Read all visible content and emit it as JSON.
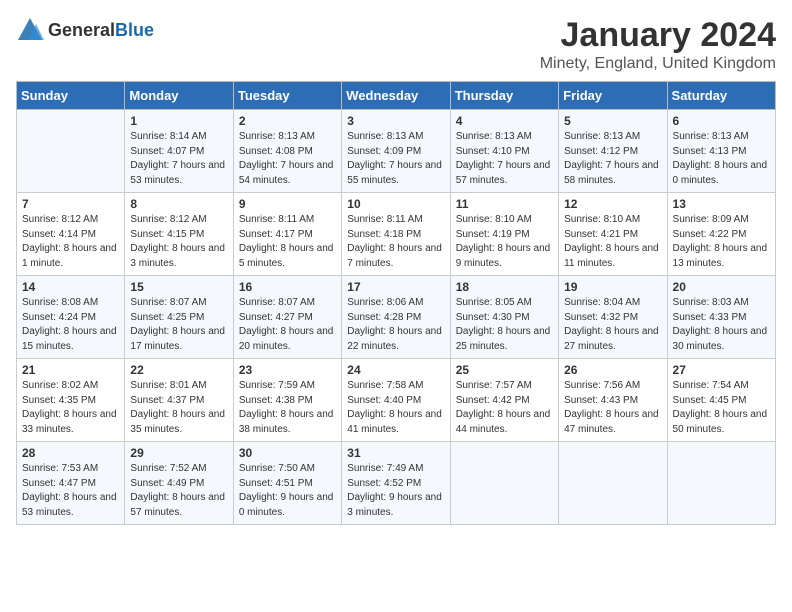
{
  "header": {
    "logo": {
      "text_general": "General",
      "text_blue": "Blue"
    },
    "title": "January 2024",
    "subtitle": "Minety, England, United Kingdom"
  },
  "days_of_week": [
    "Sunday",
    "Monday",
    "Tuesday",
    "Wednesday",
    "Thursday",
    "Friday",
    "Saturday"
  ],
  "weeks": [
    [
      {
        "day": "",
        "sunrise": "",
        "sunset": "",
        "daylight": ""
      },
      {
        "day": "1",
        "sunrise": "Sunrise: 8:14 AM",
        "sunset": "Sunset: 4:07 PM",
        "daylight": "Daylight: 7 hours and 53 minutes."
      },
      {
        "day": "2",
        "sunrise": "Sunrise: 8:13 AM",
        "sunset": "Sunset: 4:08 PM",
        "daylight": "Daylight: 7 hours and 54 minutes."
      },
      {
        "day": "3",
        "sunrise": "Sunrise: 8:13 AM",
        "sunset": "Sunset: 4:09 PM",
        "daylight": "Daylight: 7 hours and 55 minutes."
      },
      {
        "day": "4",
        "sunrise": "Sunrise: 8:13 AM",
        "sunset": "Sunset: 4:10 PM",
        "daylight": "Daylight: 7 hours and 57 minutes."
      },
      {
        "day": "5",
        "sunrise": "Sunrise: 8:13 AM",
        "sunset": "Sunset: 4:12 PM",
        "daylight": "Daylight: 7 hours and 58 minutes."
      },
      {
        "day": "6",
        "sunrise": "Sunrise: 8:13 AM",
        "sunset": "Sunset: 4:13 PM",
        "daylight": "Daylight: 8 hours and 0 minutes."
      }
    ],
    [
      {
        "day": "7",
        "sunrise": "Sunrise: 8:12 AM",
        "sunset": "Sunset: 4:14 PM",
        "daylight": "Daylight: 8 hours and 1 minute."
      },
      {
        "day": "8",
        "sunrise": "Sunrise: 8:12 AM",
        "sunset": "Sunset: 4:15 PM",
        "daylight": "Daylight: 8 hours and 3 minutes."
      },
      {
        "day": "9",
        "sunrise": "Sunrise: 8:11 AM",
        "sunset": "Sunset: 4:17 PM",
        "daylight": "Daylight: 8 hours and 5 minutes."
      },
      {
        "day": "10",
        "sunrise": "Sunrise: 8:11 AM",
        "sunset": "Sunset: 4:18 PM",
        "daylight": "Daylight: 8 hours and 7 minutes."
      },
      {
        "day": "11",
        "sunrise": "Sunrise: 8:10 AM",
        "sunset": "Sunset: 4:19 PM",
        "daylight": "Daylight: 8 hours and 9 minutes."
      },
      {
        "day": "12",
        "sunrise": "Sunrise: 8:10 AM",
        "sunset": "Sunset: 4:21 PM",
        "daylight": "Daylight: 8 hours and 11 minutes."
      },
      {
        "day": "13",
        "sunrise": "Sunrise: 8:09 AM",
        "sunset": "Sunset: 4:22 PM",
        "daylight": "Daylight: 8 hours and 13 minutes."
      }
    ],
    [
      {
        "day": "14",
        "sunrise": "Sunrise: 8:08 AM",
        "sunset": "Sunset: 4:24 PM",
        "daylight": "Daylight: 8 hours and 15 minutes."
      },
      {
        "day": "15",
        "sunrise": "Sunrise: 8:07 AM",
        "sunset": "Sunset: 4:25 PM",
        "daylight": "Daylight: 8 hours and 17 minutes."
      },
      {
        "day": "16",
        "sunrise": "Sunrise: 8:07 AM",
        "sunset": "Sunset: 4:27 PM",
        "daylight": "Daylight: 8 hours and 20 minutes."
      },
      {
        "day": "17",
        "sunrise": "Sunrise: 8:06 AM",
        "sunset": "Sunset: 4:28 PM",
        "daylight": "Daylight: 8 hours and 22 minutes."
      },
      {
        "day": "18",
        "sunrise": "Sunrise: 8:05 AM",
        "sunset": "Sunset: 4:30 PM",
        "daylight": "Daylight: 8 hours and 25 minutes."
      },
      {
        "day": "19",
        "sunrise": "Sunrise: 8:04 AM",
        "sunset": "Sunset: 4:32 PM",
        "daylight": "Daylight: 8 hours and 27 minutes."
      },
      {
        "day": "20",
        "sunrise": "Sunrise: 8:03 AM",
        "sunset": "Sunset: 4:33 PM",
        "daylight": "Daylight: 8 hours and 30 minutes."
      }
    ],
    [
      {
        "day": "21",
        "sunrise": "Sunrise: 8:02 AM",
        "sunset": "Sunset: 4:35 PM",
        "daylight": "Daylight: 8 hours and 33 minutes."
      },
      {
        "day": "22",
        "sunrise": "Sunrise: 8:01 AM",
        "sunset": "Sunset: 4:37 PM",
        "daylight": "Daylight: 8 hours and 35 minutes."
      },
      {
        "day": "23",
        "sunrise": "Sunrise: 7:59 AM",
        "sunset": "Sunset: 4:38 PM",
        "daylight": "Daylight: 8 hours and 38 minutes."
      },
      {
        "day": "24",
        "sunrise": "Sunrise: 7:58 AM",
        "sunset": "Sunset: 4:40 PM",
        "daylight": "Daylight: 8 hours and 41 minutes."
      },
      {
        "day": "25",
        "sunrise": "Sunrise: 7:57 AM",
        "sunset": "Sunset: 4:42 PM",
        "daylight": "Daylight: 8 hours and 44 minutes."
      },
      {
        "day": "26",
        "sunrise": "Sunrise: 7:56 AM",
        "sunset": "Sunset: 4:43 PM",
        "daylight": "Daylight: 8 hours and 47 minutes."
      },
      {
        "day": "27",
        "sunrise": "Sunrise: 7:54 AM",
        "sunset": "Sunset: 4:45 PM",
        "daylight": "Daylight: 8 hours and 50 minutes."
      }
    ],
    [
      {
        "day": "28",
        "sunrise": "Sunrise: 7:53 AM",
        "sunset": "Sunset: 4:47 PM",
        "daylight": "Daylight: 8 hours and 53 minutes."
      },
      {
        "day": "29",
        "sunrise": "Sunrise: 7:52 AM",
        "sunset": "Sunset: 4:49 PM",
        "daylight": "Daylight: 8 hours and 57 minutes."
      },
      {
        "day": "30",
        "sunrise": "Sunrise: 7:50 AM",
        "sunset": "Sunset: 4:51 PM",
        "daylight": "Daylight: 9 hours and 0 minutes."
      },
      {
        "day": "31",
        "sunrise": "Sunrise: 7:49 AM",
        "sunset": "Sunset: 4:52 PM",
        "daylight": "Daylight: 9 hours and 3 minutes."
      },
      {
        "day": "",
        "sunrise": "",
        "sunset": "",
        "daylight": ""
      },
      {
        "day": "",
        "sunrise": "",
        "sunset": "",
        "daylight": ""
      },
      {
        "day": "",
        "sunrise": "",
        "sunset": "",
        "daylight": ""
      }
    ]
  ]
}
